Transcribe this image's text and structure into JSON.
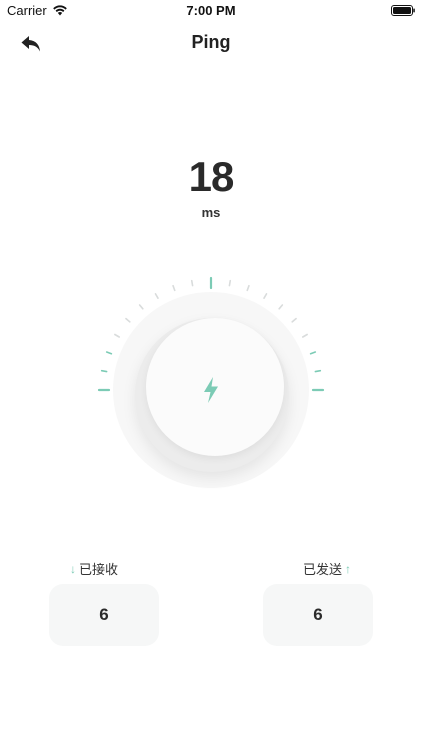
{
  "status_bar": {
    "carrier": "Carrier",
    "time": "7:00 PM",
    "wifi_icon": "wifi-icon",
    "battery_icon": "battery-full-icon"
  },
  "nav": {
    "title": "Ping",
    "back_icon": "back-arrow-icon"
  },
  "ping": {
    "value": "18",
    "unit": "ms"
  },
  "gauge": {
    "center_icon": "lightning-bolt-icon",
    "accent_color": "#7ccbb5"
  },
  "stats": {
    "received": {
      "label": "已接收",
      "arrow": "↓",
      "value": "6"
    },
    "sent": {
      "label": "已发送",
      "arrow": "↑",
      "value": "6"
    }
  },
  "colors": {
    "accent": "#7ccbb5",
    "background": "#ffffff",
    "card": "#f6f7f7"
  }
}
